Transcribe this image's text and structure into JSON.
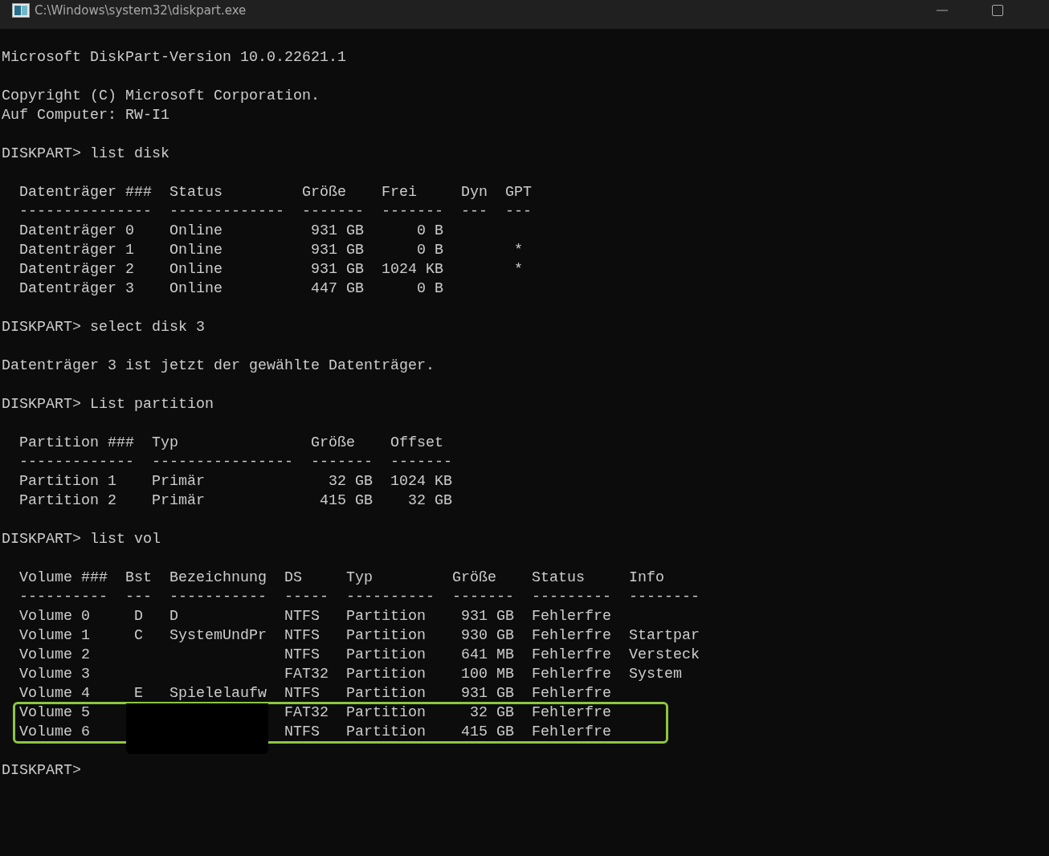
{
  "window": {
    "title": "C:\\Windows\\system32\\diskpart.exe"
  },
  "console": {
    "blocks": [
      {
        "lines": [
          "Microsoft DiskPart-Version 10.0.22621.1"
        ]
      },
      {
        "lines": [
          "Copyright (C) Microsoft Corporation.",
          "Auf Computer: RW-I1"
        ]
      },
      {
        "lines": [
          "DISKPART> list disk"
        ]
      },
      {
        "lines": [
          "  Datenträger ###  Status         Größe    Frei     Dyn  GPT",
          "  ---------------  -------------  -------  -------  ---  ---",
          "  Datenträger 0    Online          931 GB      0 B",
          "  Datenträger 1    Online          931 GB      0 B        *",
          "  Datenträger 2    Online          931 GB  1024 KB        *",
          "  Datenträger 3    Online          447 GB      0 B"
        ]
      },
      {
        "lines": [
          "DISKPART> select disk 3"
        ]
      },
      {
        "lines": [
          "Datenträger 3 ist jetzt der gewählte Datenträger."
        ]
      },
      {
        "lines": [
          "DISKPART> List partition"
        ]
      },
      {
        "lines": [
          "  Partition ###  Typ               Größe    Offset",
          "  -------------  ----------------  -------  -------",
          "  Partition 1    Primär              32 GB  1024 KB",
          "  Partition 2    Primär             415 GB    32 GB"
        ]
      },
      {
        "lines": [
          "DISKPART> list vol"
        ]
      },
      {
        "lines": [
          "  Volume ###  Bst  Bezeichnung  DS     Typ         Größe    Status     Info",
          "  ----------  ---  -----------  -----  ----------  -------  ---------  --------",
          "  Volume 0     D   D            NTFS   Partition    931 GB  Fehlerfre",
          "  Volume 1     C   SystemUndPr  NTFS   Partition    930 GB  Fehlerfre  Startpar",
          "  Volume 2                      NTFS   Partition    641 MB  Fehlerfre  Versteck",
          "  Volume 3                      FAT32  Partition    100 MB  Fehlerfre  System",
          "  Volume 4     E   Spielelaufw  NTFS   Partition    931 GB  Fehlerfre"
        ],
        "highlight": {
          "lines": [
            "  Volume 5                      FAT32  Partition     32 GB  Fehlerfre",
            "  Volume 6                      NTFS   Partition    415 GB  Fehlerfre"
          ],
          "redacted": true
        }
      },
      {
        "lines": [
          "DISKPART>"
        ]
      }
    ]
  }
}
